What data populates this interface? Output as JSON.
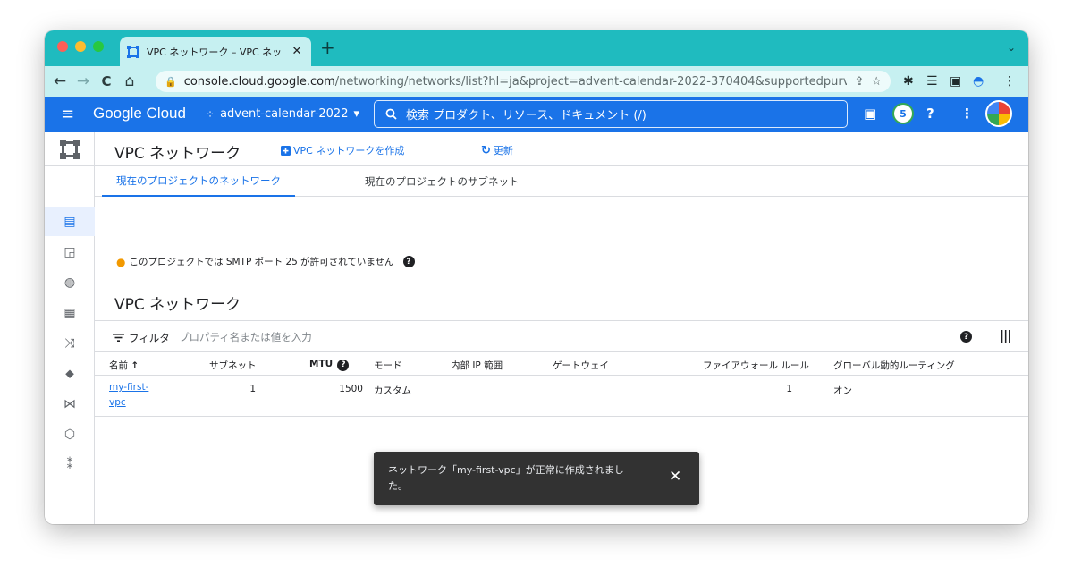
{
  "browser": {
    "tab_title": "VPC ネットワーク – VPC ネット",
    "tab_close": "✕",
    "new_tab": "+",
    "tab_menu": "⌄",
    "url_host": "console.cloud.google.com",
    "url_path": "/networking/networks/list?hl=ja&project=advent-calendar-2022-370404&supportedpurview=pr...",
    "nav_back": "←",
    "nav_forward": "→",
    "nav_reload": "C",
    "nav_home": "⌂"
  },
  "gcp_header": {
    "menu_icon": "≡",
    "brand": "Google Cloud",
    "project": "advent-calendar-2022",
    "project_caret": "▾",
    "search_placeholder": "検索 プロダクト、リソース、ドキュメント (/)",
    "search_icon": "🔍",
    "notifications_count": "5",
    "help_icon": "?",
    "more_icon": "⋮"
  },
  "sidebar": {
    "items": [
      {
        "icon": "network-list-icon"
      },
      {
        "icon": "ip-address-icon"
      },
      {
        "icon": "globe-network-icon"
      },
      {
        "icon": "grid-icon"
      },
      {
        "icon": "routes-icon"
      },
      {
        "icon": "peering-icon"
      },
      {
        "icon": "bowtie-icon"
      },
      {
        "icon": "vpn-icon"
      },
      {
        "icon": "packet-mirroring-icon"
      }
    ],
    "collapse_label": "I>"
  },
  "page": {
    "title": "VPC ネットワーク",
    "create_button": "VPC ネットワークを作成",
    "refresh_button": "更新",
    "tabs": [
      {
        "label": "現在のプロジェクトのネットワーク",
        "active": true
      },
      {
        "label": "現在のプロジェクトのサブネット",
        "active": false
      }
    ],
    "smtp_notice": "このプロジェクトでは SMTP ポート 25 が許可されていません",
    "section_title": "VPC ネットワーク",
    "filter_label": "フィルタ",
    "filter_placeholder": "プロパティ名または値を入力"
  },
  "table": {
    "columns": [
      "名前",
      "サブネット",
      "MTU",
      "モード",
      "内部 IP 範囲",
      "ゲートウェイ",
      "ファイアウォール ルール",
      "グローバル動的ルーティング"
    ],
    "sort_arrow": "↑",
    "rows": [
      {
        "name_line1": "my-first-",
        "name_line2": "vpc",
        "subnets": "1",
        "mtu": "1500",
        "mode": "カスタム",
        "internal_ip": "",
        "gateway": "",
        "firewall_rules": "1",
        "global_routing": "オン"
      }
    ]
  },
  "toast": {
    "message": "ネットワーク「my-first-vpc」が正常に作成されました。",
    "close": "✕"
  },
  "colors": {
    "tab_bar": "#1fbbbf",
    "gcp_blue": "#1a73e8",
    "link": "#1a73e8",
    "toast_bg": "#323232"
  }
}
